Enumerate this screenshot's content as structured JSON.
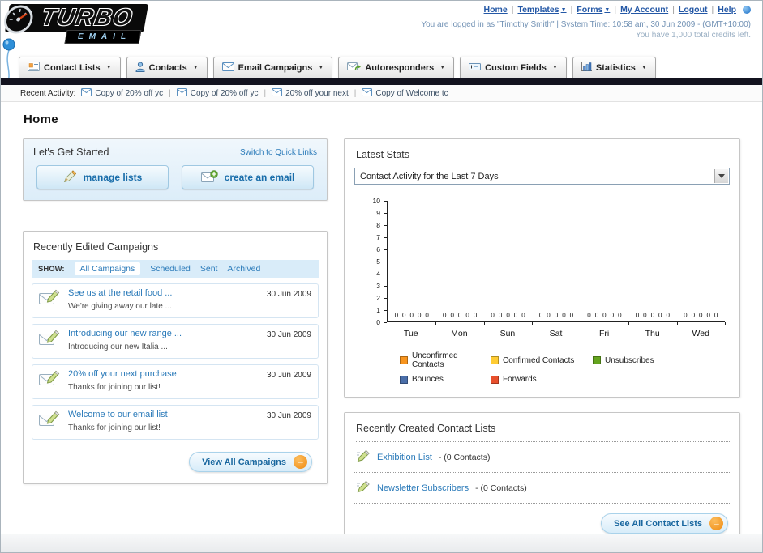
{
  "header": {
    "logo": {
      "title": "TURBO",
      "subtitle": "EMAIL"
    },
    "nav_links": [
      "Home",
      "Templates",
      "Forms",
      "My Account",
      "Logout",
      "Help"
    ],
    "login_info": "You are logged in as \"Timothy Smith\" | System Time: 10:58 am, 30 Jun 2009 - (GMT+10:00)",
    "credits_info": "You have 1,000 total credits left."
  },
  "nav_tabs": [
    {
      "label": "Contact Lists",
      "icon": "contact-lists-icon"
    },
    {
      "label": "Contacts",
      "icon": "contacts-icon"
    },
    {
      "label": "Email Campaigns",
      "icon": "email-campaigns-icon"
    },
    {
      "label": "Autoresponders",
      "icon": "autoresponders-icon"
    },
    {
      "label": "Custom Fields",
      "icon": "custom-fields-icon"
    },
    {
      "label": "Statistics",
      "icon": "statistics-icon"
    }
  ],
  "recent_activity": {
    "label": "Recent Activity:",
    "items": [
      "Copy of 20% off yc",
      "Copy of 20% off yc",
      "20% off your next",
      "Copy of Welcome tc"
    ]
  },
  "page_title": "Home",
  "get_started": {
    "title": "Let's Get Started",
    "switch_link": "Switch to Quick Links",
    "buttons": [
      {
        "label": "manage lists"
      },
      {
        "label": "create an email"
      }
    ]
  },
  "campaigns_panel": {
    "title": "Recently Edited Campaigns",
    "show_label": "SHOW:",
    "filters": [
      "All Campaigns",
      "Scheduled",
      "Sent",
      "Archived"
    ],
    "active_filter": "All Campaigns",
    "items": [
      {
        "title": "See us at the retail food ...",
        "subtitle": "We're giving away our late ...",
        "date": "30 Jun 2009"
      },
      {
        "title": "Introducing our new range ...",
        "subtitle": "Introducing our new Italia ...",
        "date": "30 Jun 2009"
      },
      {
        "title": "20% off your next purchase",
        "subtitle": "Thanks for joining our list!",
        "date": "30 Jun 2009"
      },
      {
        "title": "Welcome to our email list",
        "subtitle": "Thanks for joining our list!",
        "date": "30 Jun 2009"
      }
    ],
    "view_all_label": "View All Campaigns"
  },
  "stats_panel": {
    "title": "Latest Stats",
    "dropdown_value": "Contact Activity for the Last 7 Days"
  },
  "chart_data": {
    "type": "bar",
    "title": "Contact Activity for the Last 7 Days",
    "categories": [
      "Tue",
      "Mon",
      "Sun",
      "Sat",
      "Fri",
      "Thu",
      "Wed"
    ],
    "series": [
      {
        "name": "Unconfirmed Contacts",
        "color": "#F7941E",
        "values": [
          0,
          0,
          0,
          0,
          0,
          0,
          0
        ]
      },
      {
        "name": "Confirmed Contacts",
        "color": "#FFCC33",
        "values": [
          0,
          0,
          0,
          0,
          0,
          0,
          0
        ]
      },
      {
        "name": "Unsubscribes",
        "color": "#64A41E",
        "values": [
          0,
          0,
          0,
          0,
          0,
          0,
          0
        ]
      },
      {
        "name": "Bounces",
        "color": "#4A6EA9",
        "values": [
          0,
          0,
          0,
          0,
          0,
          0,
          0
        ]
      },
      {
        "name": "Forwards",
        "color": "#E8502D",
        "values": [
          0,
          0,
          0,
          0,
          0,
          0,
          0
        ]
      }
    ],
    "ylim": [
      0,
      10
    ],
    "grid": false,
    "legend_position": "bottom"
  },
  "contact_lists_panel": {
    "title": "Recently Created Contact Lists",
    "items": [
      {
        "name": "Exhibition List",
        "suffix": "- (0 Contacts)"
      },
      {
        "name": "Newsletter Subscribers",
        "suffix": "- (0 Contacts)"
      }
    ],
    "see_all_label": "See All Contact Lists"
  }
}
